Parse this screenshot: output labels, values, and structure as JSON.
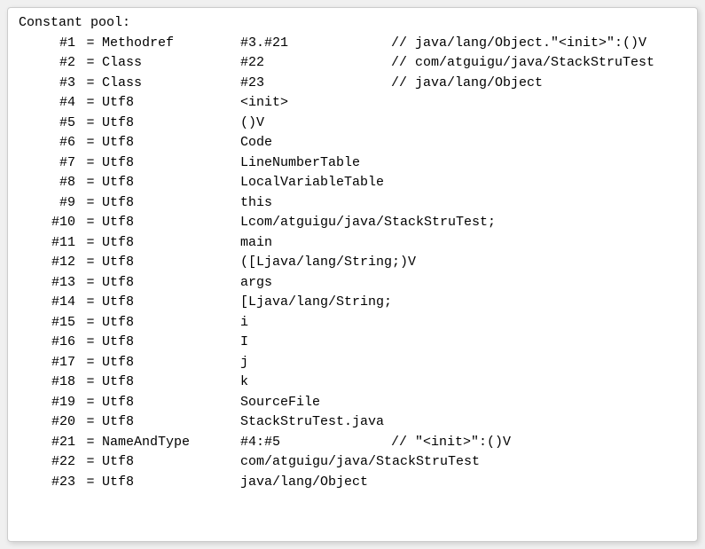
{
  "header": "Constant pool:",
  "rows": [
    {
      "index": "#1",
      "eq": "=",
      "type": "Methodref",
      "value": "#3.#21",
      "comment": "// java/lang/Object.\"<init>\":()V"
    },
    {
      "index": "#2",
      "eq": "=",
      "type": "Class",
      "value": "#22",
      "comment": "// com/atguigu/java/StackStruTest"
    },
    {
      "index": "#3",
      "eq": "=",
      "type": "Class",
      "value": "#23",
      "comment": "// java/lang/Object"
    },
    {
      "index": "#4",
      "eq": "=",
      "type": "Utf8",
      "value": "<init>",
      "comment": ""
    },
    {
      "index": "#5",
      "eq": "=",
      "type": "Utf8",
      "value": "()V",
      "comment": ""
    },
    {
      "index": "#6",
      "eq": "=",
      "type": "Utf8",
      "value": "Code",
      "comment": ""
    },
    {
      "index": "#7",
      "eq": "=",
      "type": "Utf8",
      "value": "LineNumberTable",
      "comment": ""
    },
    {
      "index": "#8",
      "eq": "=",
      "type": "Utf8",
      "value": "LocalVariableTable",
      "comment": ""
    },
    {
      "index": "#9",
      "eq": "=",
      "type": "Utf8",
      "value": "this",
      "comment": ""
    },
    {
      "index": "#10",
      "eq": "=",
      "type": "Utf8",
      "value": "Lcom/atguigu/java/StackStruTest;",
      "comment": ""
    },
    {
      "index": "#11",
      "eq": "=",
      "type": "Utf8",
      "value": "main",
      "comment": ""
    },
    {
      "index": "#12",
      "eq": "=",
      "type": "Utf8",
      "value": "([Ljava/lang/String;)V",
      "comment": ""
    },
    {
      "index": "#13",
      "eq": "=",
      "type": "Utf8",
      "value": "args",
      "comment": ""
    },
    {
      "index": "#14",
      "eq": "=",
      "type": "Utf8",
      "value": "[Ljava/lang/String;",
      "comment": ""
    },
    {
      "index": "#15",
      "eq": "=",
      "type": "Utf8",
      "value": "i",
      "comment": ""
    },
    {
      "index": "#16",
      "eq": "=",
      "type": "Utf8",
      "value": "I",
      "comment": ""
    },
    {
      "index": "#17",
      "eq": "=",
      "type": "Utf8",
      "value": "j",
      "comment": ""
    },
    {
      "index": "#18",
      "eq": "=",
      "type": "Utf8",
      "value": "k",
      "comment": ""
    },
    {
      "index": "#19",
      "eq": "=",
      "type": "Utf8",
      "value": "SourceFile",
      "comment": ""
    },
    {
      "index": "#20",
      "eq": "=",
      "type": "Utf8",
      "value": "StackStruTest.java",
      "comment": ""
    },
    {
      "index": "#21",
      "eq": "=",
      "type": "NameAndType",
      "value": "#4:#5",
      "comment": "// \"<init>\":()V"
    },
    {
      "index": "#22",
      "eq": "=",
      "type": "Utf8",
      "value": "com/atguigu/java/StackStruTest",
      "comment": ""
    },
    {
      "index": "#23",
      "eq": "=",
      "type": "Utf8",
      "value": "java/lang/Object",
      "comment": ""
    }
  ]
}
